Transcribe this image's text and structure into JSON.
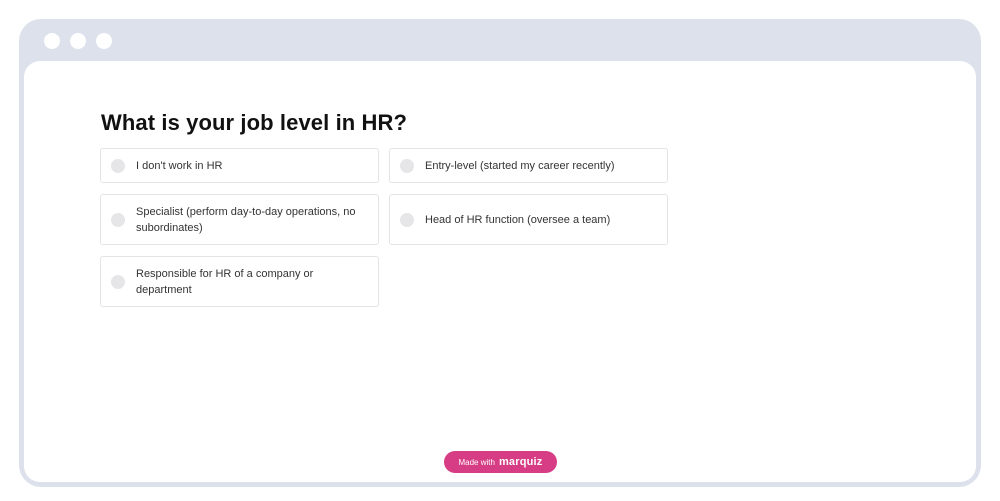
{
  "window": {
    "dots": [
      "window-dot",
      "window-dot",
      "window-dot"
    ]
  },
  "quiz": {
    "question": "What is your job level in HR?",
    "options": [
      {
        "label": "I don't work in HR"
      },
      {
        "label": "Entry-level (started my career recently)"
      },
      {
        "label": "Specialist (perform day-to-day operations, no subordinates)"
      },
      {
        "label": "Head of HR function (oversee a team)"
      },
      {
        "label": "Responsible for HR of a company or department"
      }
    ]
  },
  "footer": {
    "made_with": "Made with",
    "brand": "marquiz"
  },
  "colors": {
    "frame": "#dde1ec",
    "badge": "#d63d84",
    "radio": "#e6e6e9",
    "option_border": "#e3e4e8"
  }
}
